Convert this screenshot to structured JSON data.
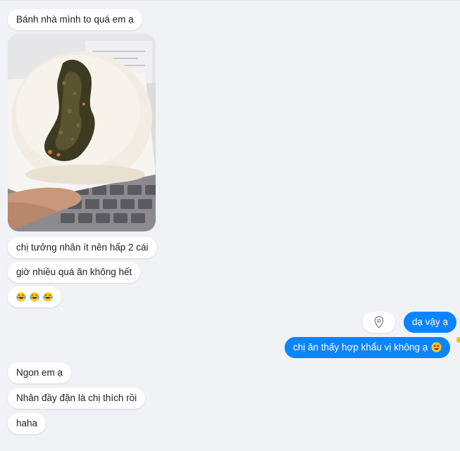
{
  "messages": {
    "m1": "Bánh nhà mình to quá em ạ",
    "m2": "chị tưởng nhân ít nên hấp 2 cái",
    "m3": "giờ nhiều quá ăn không hết",
    "m4_emoji": "laughing-crying-emoji x3",
    "out1": "dạ vậy ạ",
    "out2": "chị ăn thấy hợp khẩu vị không ạ",
    "out2_emoji": "heart-eyes-emoji",
    "m5": "Ngon em ạ",
    "m6": "Nhân đầy đặn là chị thích rồi",
    "m7": "haha"
  },
  "photo": {
    "subject": "steamed bun cut open showing filling, held over a laptop keyboard"
  },
  "icons": {
    "pin": "location-pin-icon"
  },
  "colors": {
    "background": "#f1f2f5",
    "incoming_bubble": "#ffffff",
    "outgoing_bubble": "#0a84ff",
    "text": "#1c1e21"
  }
}
